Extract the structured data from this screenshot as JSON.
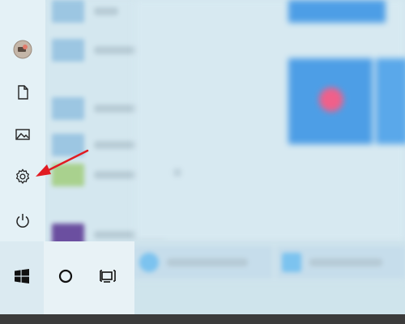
{
  "rail": {
    "items": [
      {
        "name": "user-avatar",
        "icon": "user-avatar"
      },
      {
        "name": "documents",
        "icon": "document-icon"
      },
      {
        "name": "pictures",
        "icon": "image-icon"
      },
      {
        "name": "settings",
        "icon": "gear-icon"
      },
      {
        "name": "power",
        "icon": "power-icon"
      }
    ]
  },
  "taskbar": {
    "items": [
      {
        "name": "start",
        "icon": "windows-logo-icon"
      },
      {
        "name": "search",
        "icon": "search-circle-icon"
      },
      {
        "name": "task-view",
        "icon": "task-view-icon"
      }
    ]
  },
  "annotation": {
    "arrow_color": "#e11b22",
    "points_to": "settings"
  },
  "colors": {
    "tile_blue": "#4d9ee6",
    "accent_pink": "#f0608a",
    "rail_bg": "#e4f1f6",
    "taskbar_dark": "#3b3b3b"
  }
}
